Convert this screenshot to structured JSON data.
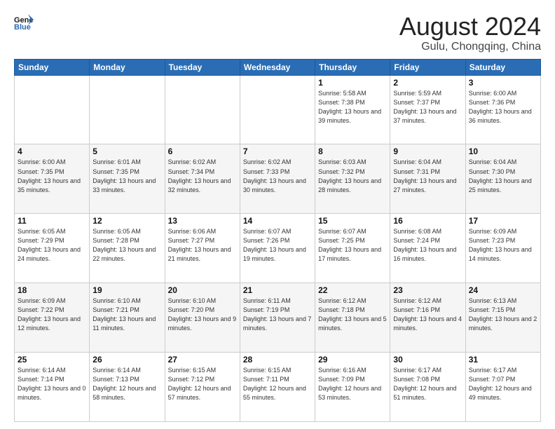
{
  "header": {
    "logo_general": "General",
    "logo_blue": "Blue",
    "title": "August 2024",
    "subtitle": "Gulu, Chongqing, China"
  },
  "weekdays": [
    "Sunday",
    "Monday",
    "Tuesday",
    "Wednesday",
    "Thursday",
    "Friday",
    "Saturday"
  ],
  "weeks": [
    [
      {
        "day": "",
        "sunrise": "",
        "sunset": "",
        "daylight": ""
      },
      {
        "day": "",
        "sunrise": "",
        "sunset": "",
        "daylight": ""
      },
      {
        "day": "",
        "sunrise": "",
        "sunset": "",
        "daylight": ""
      },
      {
        "day": "",
        "sunrise": "",
        "sunset": "",
        "daylight": ""
      },
      {
        "day": "1",
        "sunrise": "Sunrise: 5:58 AM",
        "sunset": "Sunset: 7:38 PM",
        "daylight": "Daylight: 13 hours and 39 minutes."
      },
      {
        "day": "2",
        "sunrise": "Sunrise: 5:59 AM",
        "sunset": "Sunset: 7:37 PM",
        "daylight": "Daylight: 13 hours and 37 minutes."
      },
      {
        "day": "3",
        "sunrise": "Sunrise: 6:00 AM",
        "sunset": "Sunset: 7:36 PM",
        "daylight": "Daylight: 13 hours and 36 minutes."
      }
    ],
    [
      {
        "day": "4",
        "sunrise": "Sunrise: 6:00 AM",
        "sunset": "Sunset: 7:35 PM",
        "daylight": "Daylight: 13 hours and 35 minutes."
      },
      {
        "day": "5",
        "sunrise": "Sunrise: 6:01 AM",
        "sunset": "Sunset: 7:35 PM",
        "daylight": "Daylight: 13 hours and 33 minutes."
      },
      {
        "day": "6",
        "sunrise": "Sunrise: 6:02 AM",
        "sunset": "Sunset: 7:34 PM",
        "daylight": "Daylight: 13 hours and 32 minutes."
      },
      {
        "day": "7",
        "sunrise": "Sunrise: 6:02 AM",
        "sunset": "Sunset: 7:33 PM",
        "daylight": "Daylight: 13 hours and 30 minutes."
      },
      {
        "day": "8",
        "sunrise": "Sunrise: 6:03 AM",
        "sunset": "Sunset: 7:32 PM",
        "daylight": "Daylight: 13 hours and 28 minutes."
      },
      {
        "day": "9",
        "sunrise": "Sunrise: 6:04 AM",
        "sunset": "Sunset: 7:31 PM",
        "daylight": "Daylight: 13 hours and 27 minutes."
      },
      {
        "day": "10",
        "sunrise": "Sunrise: 6:04 AM",
        "sunset": "Sunset: 7:30 PM",
        "daylight": "Daylight: 13 hours and 25 minutes."
      }
    ],
    [
      {
        "day": "11",
        "sunrise": "Sunrise: 6:05 AM",
        "sunset": "Sunset: 7:29 PM",
        "daylight": "Daylight: 13 hours and 24 minutes."
      },
      {
        "day": "12",
        "sunrise": "Sunrise: 6:05 AM",
        "sunset": "Sunset: 7:28 PM",
        "daylight": "Daylight: 13 hours and 22 minutes."
      },
      {
        "day": "13",
        "sunrise": "Sunrise: 6:06 AM",
        "sunset": "Sunset: 7:27 PM",
        "daylight": "Daylight: 13 hours and 21 minutes."
      },
      {
        "day": "14",
        "sunrise": "Sunrise: 6:07 AM",
        "sunset": "Sunset: 7:26 PM",
        "daylight": "Daylight: 13 hours and 19 minutes."
      },
      {
        "day": "15",
        "sunrise": "Sunrise: 6:07 AM",
        "sunset": "Sunset: 7:25 PM",
        "daylight": "Daylight: 13 hours and 17 minutes."
      },
      {
        "day": "16",
        "sunrise": "Sunrise: 6:08 AM",
        "sunset": "Sunset: 7:24 PM",
        "daylight": "Daylight: 13 hours and 16 minutes."
      },
      {
        "day": "17",
        "sunrise": "Sunrise: 6:09 AM",
        "sunset": "Sunset: 7:23 PM",
        "daylight": "Daylight: 13 hours and 14 minutes."
      }
    ],
    [
      {
        "day": "18",
        "sunrise": "Sunrise: 6:09 AM",
        "sunset": "Sunset: 7:22 PM",
        "daylight": "Daylight: 13 hours and 12 minutes."
      },
      {
        "day": "19",
        "sunrise": "Sunrise: 6:10 AM",
        "sunset": "Sunset: 7:21 PM",
        "daylight": "Daylight: 13 hours and 11 minutes."
      },
      {
        "day": "20",
        "sunrise": "Sunrise: 6:10 AM",
        "sunset": "Sunset: 7:20 PM",
        "daylight": "Daylight: 13 hours and 9 minutes."
      },
      {
        "day": "21",
        "sunrise": "Sunrise: 6:11 AM",
        "sunset": "Sunset: 7:19 PM",
        "daylight": "Daylight: 13 hours and 7 minutes."
      },
      {
        "day": "22",
        "sunrise": "Sunrise: 6:12 AM",
        "sunset": "Sunset: 7:18 PM",
        "daylight": "Daylight: 13 hours and 5 minutes."
      },
      {
        "day": "23",
        "sunrise": "Sunrise: 6:12 AM",
        "sunset": "Sunset: 7:16 PM",
        "daylight": "Daylight: 13 hours and 4 minutes."
      },
      {
        "day": "24",
        "sunrise": "Sunrise: 6:13 AM",
        "sunset": "Sunset: 7:15 PM",
        "daylight": "Daylight: 13 hours and 2 minutes."
      }
    ],
    [
      {
        "day": "25",
        "sunrise": "Sunrise: 6:14 AM",
        "sunset": "Sunset: 7:14 PM",
        "daylight": "Daylight: 13 hours and 0 minutes."
      },
      {
        "day": "26",
        "sunrise": "Sunrise: 6:14 AM",
        "sunset": "Sunset: 7:13 PM",
        "daylight": "Daylight: 12 hours and 58 minutes."
      },
      {
        "day": "27",
        "sunrise": "Sunrise: 6:15 AM",
        "sunset": "Sunset: 7:12 PM",
        "daylight": "Daylight: 12 hours and 57 minutes."
      },
      {
        "day": "28",
        "sunrise": "Sunrise: 6:15 AM",
        "sunset": "Sunset: 7:11 PM",
        "daylight": "Daylight: 12 hours and 55 minutes."
      },
      {
        "day": "29",
        "sunrise": "Sunrise: 6:16 AM",
        "sunset": "Sunset: 7:09 PM",
        "daylight": "Daylight: 12 hours and 53 minutes."
      },
      {
        "day": "30",
        "sunrise": "Sunrise: 6:17 AM",
        "sunset": "Sunset: 7:08 PM",
        "daylight": "Daylight: 12 hours and 51 minutes."
      },
      {
        "day": "31",
        "sunrise": "Sunrise: 6:17 AM",
        "sunset": "Sunset: 7:07 PM",
        "daylight": "Daylight: 12 hours and 49 minutes."
      }
    ]
  ]
}
